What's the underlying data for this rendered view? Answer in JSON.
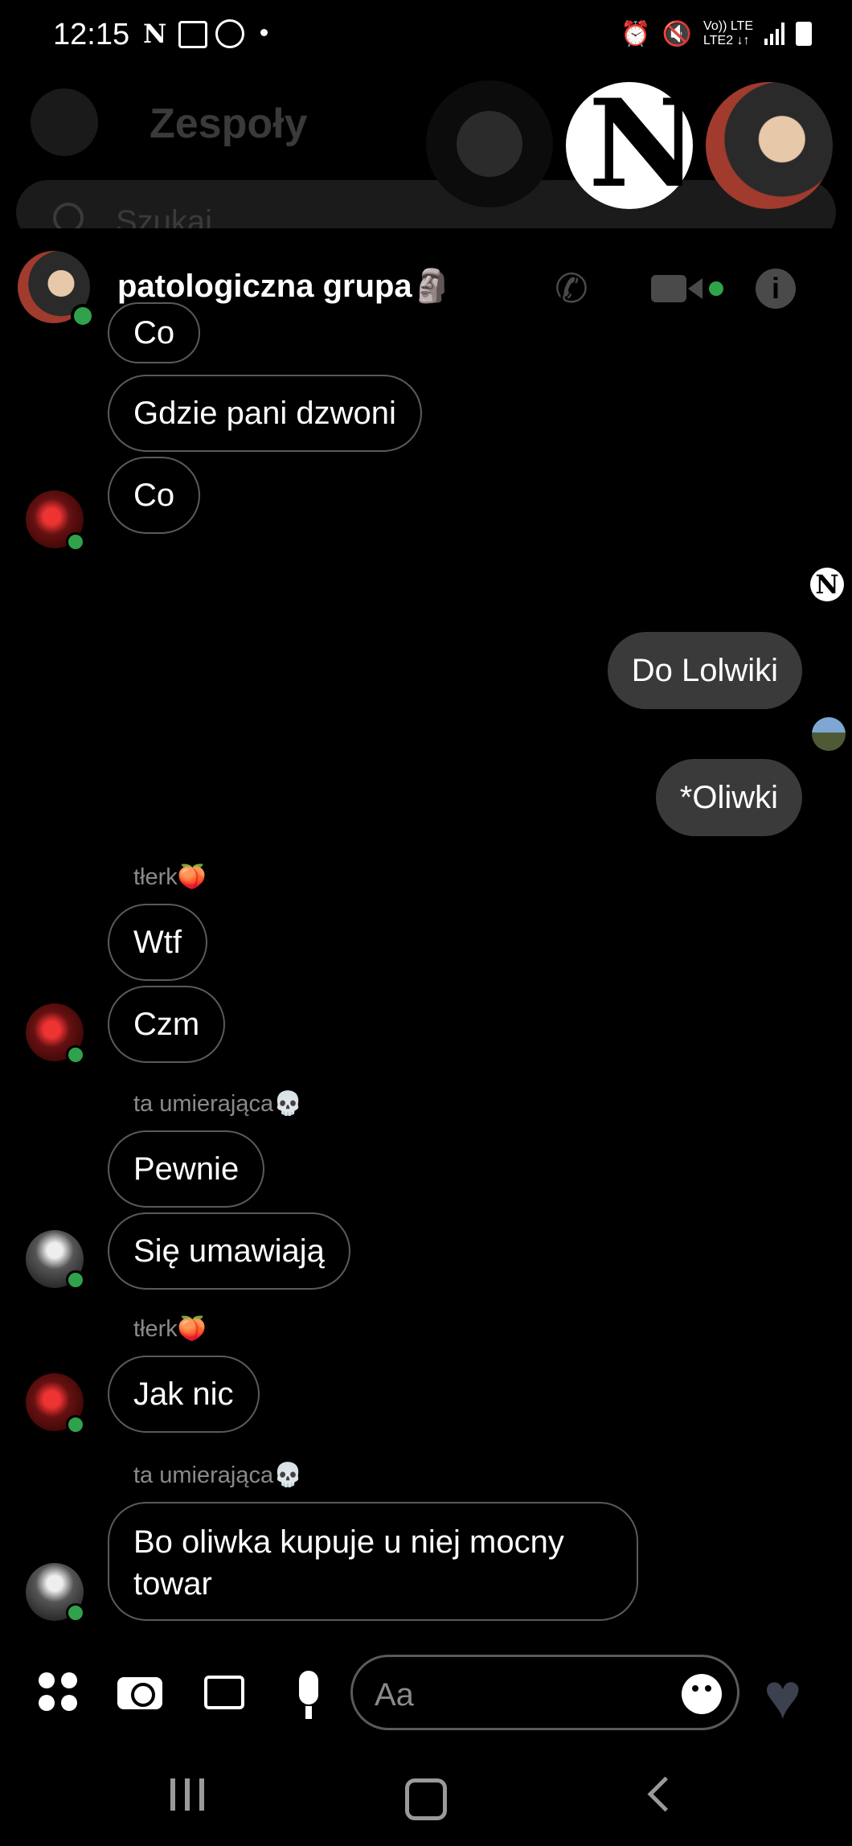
{
  "status_bar": {
    "time": "12:15",
    "network_top": "Vo)) LTE",
    "network_bottom": "LTE2 ↓↑",
    "icons": [
      "netflix-n-icon",
      "gallery-icon",
      "messenger-icon",
      "dot-icon",
      "alarm-icon",
      "mute-icon",
      "signal-icon",
      "battery-icon"
    ]
  },
  "background_app": {
    "title": "Zespoły",
    "search_placeholder": "Szukaj"
  },
  "chat_heads": [
    {
      "name": "messenger-chathead"
    },
    {
      "name": "n-logo-chathead",
      "letter": "N"
    },
    {
      "name": "contact-chathead"
    }
  ],
  "chat": {
    "title": "patologiczna grupa🗿",
    "messages": [
      {
        "side": "in",
        "text": "Co"
      },
      {
        "side": "in",
        "text": "Gdzie pani dzwoni"
      },
      {
        "side": "in",
        "text": "Co"
      },
      {
        "side": "out",
        "text": "Do Lolwiki"
      },
      {
        "side": "out",
        "text": "*Oliwki"
      },
      {
        "side": "in",
        "sender": "tłerk🍑",
        "text": "Wtf"
      },
      {
        "side": "in",
        "text": "Czm"
      },
      {
        "side": "in",
        "sender": "ta umierająca💀",
        "text": "Pewnie"
      },
      {
        "side": "in",
        "text": "Się umawiają"
      },
      {
        "side": "in",
        "sender": "tłerk🍑",
        "text": "Jak nic"
      },
      {
        "side": "in",
        "sender": "ta umierająca💀",
        "text": "Bo oliwka kupuje u niej mocny towar"
      }
    ],
    "seen_n": "N"
  },
  "composer": {
    "placeholder": "Aa"
  },
  "colors": {
    "background": "#000000",
    "bubble_out": "#3a3a3a",
    "online": "#31a24c",
    "heart": "#3c4150"
  }
}
